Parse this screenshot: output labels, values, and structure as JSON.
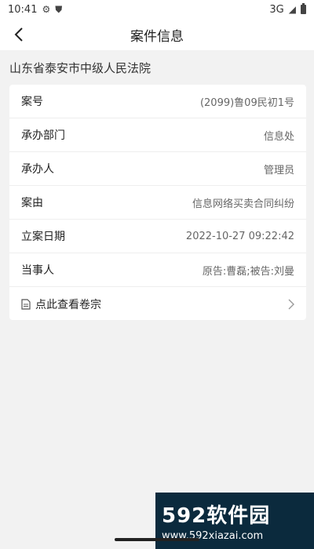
{
  "status_bar": {
    "time": "10:41",
    "network": "3G",
    "icons": [
      "settings-gear-icon",
      "shield-icon",
      "signal-icon",
      "battery-icon"
    ]
  },
  "header": {
    "title": "案件信息",
    "back_icon": "chevron-left-icon"
  },
  "court_name": "山东省泰安市中级人民法院",
  "case_fields": [
    {
      "label": "案号",
      "value": "(2099)鲁09民初1号"
    },
    {
      "label": "承办部门",
      "value": "信息处"
    },
    {
      "label": "承办人",
      "value": "管理员"
    },
    {
      "label": "案由",
      "value": "信息网络买卖合同纠纷"
    },
    {
      "label": "立案日期",
      "value": "2022-10-27 09:22:42"
    },
    {
      "label": "当事人",
      "value": "原告:曹磊;被告:刘曼"
    }
  ],
  "file_link": {
    "label": "点此查看卷宗",
    "icon": "document-icon",
    "chevron": "chevron-right-icon"
  },
  "watermark": {
    "brand": "592软件园",
    "url": "www.592xiazai.com"
  }
}
